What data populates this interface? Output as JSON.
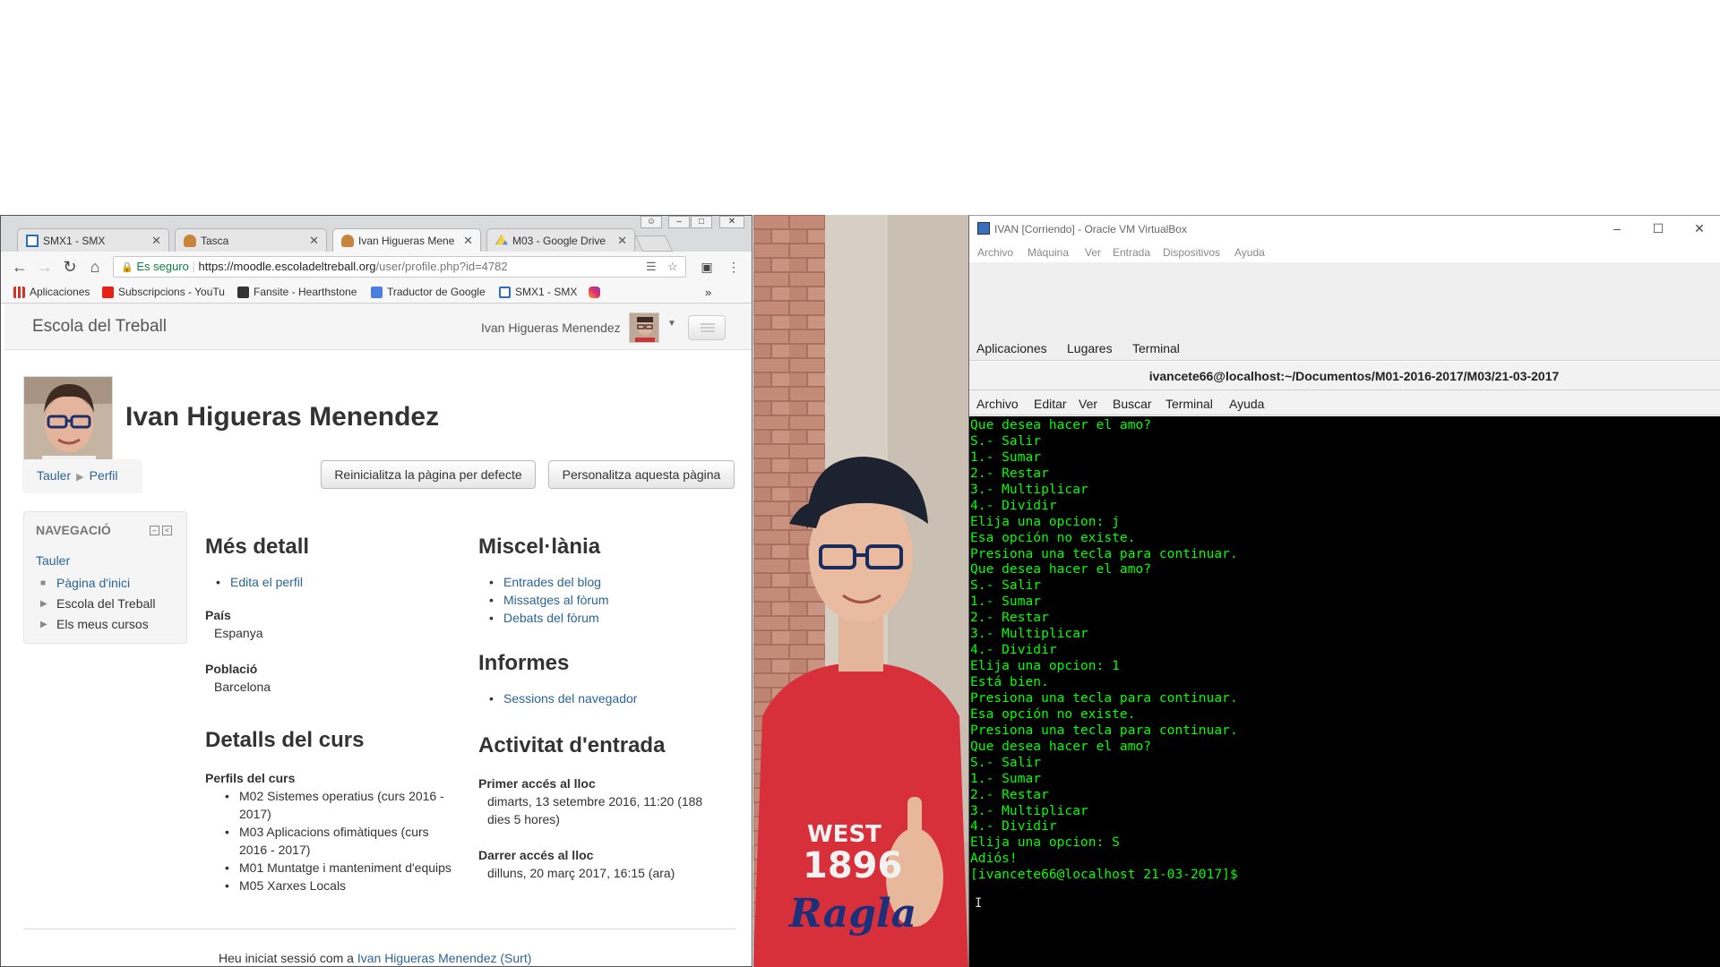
{
  "browser": {
    "tabs": [
      {
        "title": "SMX1 - SMX",
        "active": false
      },
      {
        "title": "Tasca",
        "active": false
      },
      {
        "title": "Ivan Higueras Menen",
        "active": true
      },
      {
        "title": "M03 - Google Drive",
        "active": false
      }
    ],
    "close_glyph": "✕",
    "omnibox": {
      "secure_label": "Es seguro",
      "url_host": "https://moodle.escoladeltreball.org",
      "url_path": "/user/profile.php?id=4782"
    },
    "bookmarks": [
      "Aplicaciones",
      "Subscripcions - YouTu",
      "Fansite - Hearthstone",
      "Traductor de Google",
      "SMX1 - SMX"
    ],
    "bookmarks_more": "»"
  },
  "moodle": {
    "site_name": "Escola del Treball",
    "user_menu_name": "Ivan Higueras Menendez",
    "fullname": "Ivan Higueras Menendez",
    "breadcrumb": [
      "Tauler",
      "Perfil"
    ],
    "buttons": {
      "reset": "Reinicialitza la pàgina per defecte",
      "customize": "Personalitza aquesta pàgina"
    },
    "nav_block": {
      "title": "NAVEGACIÓ",
      "root": "Tauler",
      "items": [
        "Pàgina d'inici",
        "Escola del Treball",
        "Els meus cursos"
      ]
    },
    "mes_detall": {
      "heading": "Més detall",
      "edit_link": "Edita el perfil",
      "country_label": "País",
      "country": "Espanya",
      "city_label": "Població",
      "city": "Barcelona"
    },
    "course_details": {
      "heading": "Detalls del curs",
      "profiles_label": "Perfils del curs",
      "courses": [
        [
          "M02 Sistemes operatius (curs 2016 -",
          "2017)"
        ],
        [
          "M03 Aplicacions ofimàtiques (curs",
          "2016 - 2017)"
        ],
        [
          "M01 Muntatge i manteniment d'equips"
        ],
        [
          "M05 Xarxes Locals"
        ]
      ]
    },
    "miscellany": {
      "heading": "Miscel·lània",
      "links": [
        "Entrades del blog",
        "Missatges al fòrum",
        "Debats del fòrum"
      ]
    },
    "reports": {
      "heading": "Informes",
      "links": [
        "Sessions del navegador"
      ]
    },
    "login_activity": {
      "heading": "Activitat d'entrada",
      "first_label": "Primer accés al lloc",
      "first_value_1": "dimarts, 13 setembre 2016, 11:20  (188",
      "first_value_2": "dies 5 hores)",
      "last_label": "Darrer accés al lloc",
      "last_value": "dilluns, 20 març 2017, 16:15  (ara)"
    },
    "footer": {
      "prefix": "Heu iniciat sessió com a ",
      "user_link": "Ivan Higueras Menendez (Surt)"
    }
  },
  "virtualbox": {
    "title": "IVAN [Corriendo] - Oracle VM VirtualBox",
    "menu": [
      "Archivo",
      "Máquina",
      "Ver",
      "Entrada",
      "Dispositivos",
      "Ayuda"
    ],
    "gnome_bar": [
      "Aplicaciones",
      "Lugares",
      "Terminal"
    ],
    "terminal_title": "ivancete66@localhost:~/Documentos/M01-2016-2017/M03/21-03-2017",
    "terminal_menu": [
      "Archivo",
      "Editar",
      "Ver",
      "Buscar",
      "Terminal",
      "Ayuda"
    ],
    "terminal_lines": [
      "Que desea hacer el amo?",
      "S.- Salir",
      "1.- Sumar",
      "2.- Restar",
      "3.- Multiplicar",
      "4.- Dividir",
      "Elija una opcion: j",
      "Esa opción no existe.",
      "Presiona una tecla para continuar.",
      "Que desea hacer el amo?",
      "S.- Salir",
      "1.- Sumar",
      "2.- Restar",
      "3.- Multiplicar",
      "4.- Dividir",
      "Elija una opcion: 1",
      "Está bien.",
      "Presiona una tecla para continuar.",
      "Esa opción no existe.",
      "Presiona una tecla para continuar.",
      "Que desea hacer el amo?",
      "S.- Salir",
      "1.- Sumar",
      "2.- Restar",
      "3.- Multiplicar",
      "4.- Dividir",
      "Elija una opcion: S",
      "Adiós!",
      "[ivancete66@localhost 21-03-2017]$"
    ],
    "terminal_color": "#00ff00"
  },
  "desktop_photo": {
    "shirt_text_1": "WEST",
    "shirt_text_2": "1896",
    "shirt_text_3": "Ragla"
  }
}
